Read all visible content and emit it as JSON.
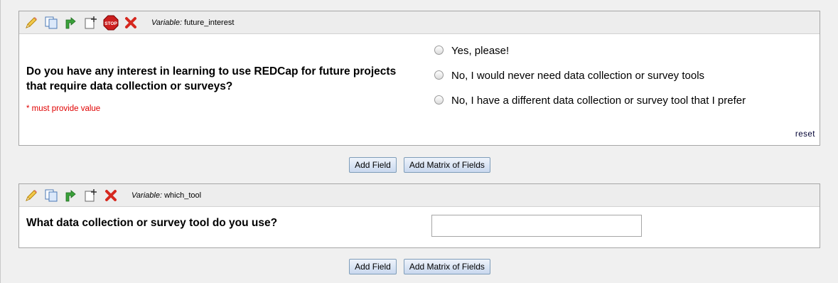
{
  "buttons": {
    "add_field": "Add Field",
    "add_matrix": "Add Matrix of Fields"
  },
  "fields": [
    {
      "variable_key": "Variable:",
      "variable_name": "future_interest",
      "toolbar_icons": [
        "pencil-icon",
        "copy-icon",
        "branching-logic-icon",
        "move-icon",
        "stop-action-icon",
        "delete-icon"
      ],
      "question": "Do you have any interest in learning to use REDCap for future projects that require data collection or surveys?",
      "required_note": "* must provide value",
      "choices": [
        "Yes, please!",
        "No, I would never need data collection or survey tools",
        "No, I have a different data collection or survey tool that I prefer"
      ],
      "reset_label": "reset"
    },
    {
      "variable_key": "Variable:",
      "variable_name": "which_tool",
      "toolbar_icons": [
        "pencil-icon",
        "copy-icon",
        "branching-logic-icon",
        "move-icon",
        "delete-icon"
      ],
      "question": "What data collection or survey tool do you use?",
      "input_value": ""
    }
  ],
  "colors": {
    "required": "#e00000",
    "panel_bg": "#f0f0f0",
    "toolbar_bg": "#ededed"
  }
}
